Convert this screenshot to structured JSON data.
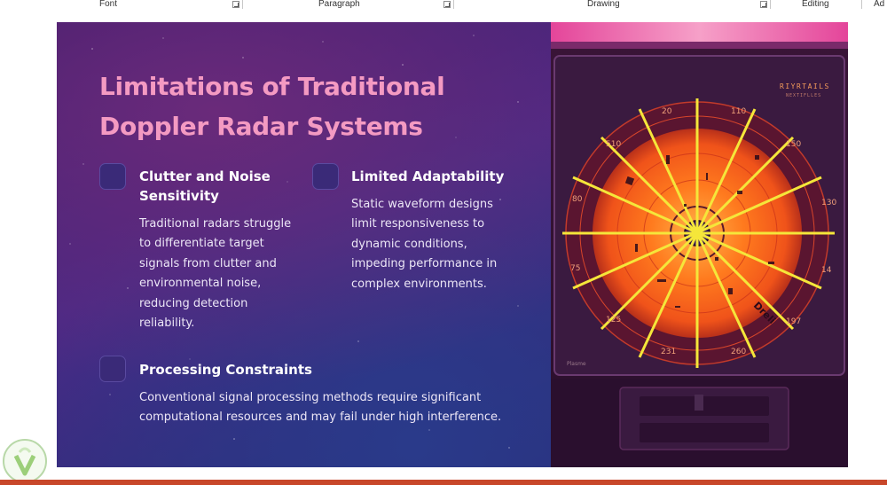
{
  "ribbon": {
    "groups": [
      "Font",
      "Paragraph",
      "Drawing",
      "Editing",
      "Ad"
    ]
  },
  "slide": {
    "title_line1": "Limitations of Traditional",
    "title_line2": "Doppler Radar Systems",
    "cards": [
      {
        "title_lines": [
          "Clutter and Noise",
          "Sensitivity"
        ],
        "text_lines": [
          "Traditional radars struggle",
          "to differentiate target",
          "signals from clutter and",
          "environmental noise,",
          "reducing detection",
          "reliability."
        ]
      },
      {
        "title_lines": [
          "Limited Adaptability"
        ],
        "text_lines": [
          "Static waveform designs",
          "limit responsiveness to",
          "dynamic conditions,",
          "impeding performance in",
          "complex environments."
        ]
      },
      {
        "title_lines": [
          "Processing Constraints"
        ],
        "text_lines": [
          "Conventional signal processing methods require significant",
          "computational resources and may fail under high interference."
        ]
      }
    ],
    "image": {
      "brand": "RIYRTAILS",
      "brand_sub": "NEXTIFLLES",
      "scale_labels": [
        "20",
        "110",
        "510",
        "150",
        "80",
        "130",
        "75",
        "14",
        "125",
        "197",
        "231",
        "260"
      ],
      "corner_label": "Plasme",
      "side_label": "Dreli"
    }
  },
  "colors": {
    "title": "#f49ac2",
    "card_box": "#3a2a78",
    "radar_orange": "#ff6a1a",
    "radar_lines": "#f5e63a",
    "taskbar": "#c8472a"
  }
}
